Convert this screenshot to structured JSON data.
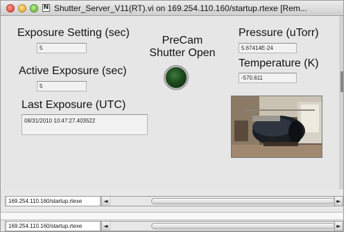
{
  "window": {
    "title": "Shutter_Server_V11(RT).vi on 169.254.110.160/startup.rtexe [Rem...",
    "app_icon_glyph": "N"
  },
  "panel": {
    "exposure_setting": {
      "label": "Exposure Setting (sec)",
      "value": "5"
    },
    "active_exposure": {
      "label": "Active Exposure (sec)",
      "value": "5"
    },
    "last_exposure": {
      "label": "Last Exposure (UTC)",
      "value": "08/31/2010 10:47:27.403522"
    },
    "shutter": {
      "label_line1": "PreCam",
      "label_line2": "Shutter Open",
      "led_color": "#1d4a1d"
    },
    "pressure": {
      "label": "Pressure (uTorr)",
      "value": "5.67414E-24"
    },
    "temperature": {
      "label": "Temperature (K)",
      "value": "-570.611"
    },
    "camera_image": "camera-photo"
  },
  "status_bars": [
    {
      "address": "169.254.110.160/startup.rtexe",
      "left_arrow": "◄",
      "right_arrow": "►"
    },
    {
      "address": "169.254.110.160/startup.rtexe",
      "left_arrow": "◄",
      "right_arrow": "►"
    }
  ],
  "colors": {
    "panel_bg": "#e6e6e6",
    "led_off": "#1d4a1d"
  }
}
